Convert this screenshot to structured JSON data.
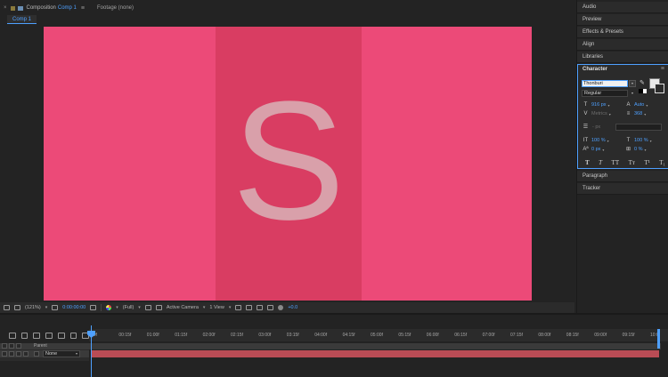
{
  "composition": {
    "close_label": "×",
    "label": "Composition",
    "name": "Comp 1",
    "menu_icon": "≡",
    "footage_label": "Footage (none)",
    "active_tab": "Comp 1",
    "canvas_letter": "S",
    "canvas_color": "#ec4a78",
    "band_color": "#d93d62"
  },
  "viewer_toolbar": {
    "zoom": "(121%)",
    "timecode": "0:00:00:00",
    "resolution": "(Full)",
    "camera": "Active Camera",
    "views": "1 View",
    "exposure": "+0.0"
  },
  "right_panel": {
    "items_top": [
      "Audio",
      "Preview",
      "Effects & Presets",
      "Align",
      "Libraries"
    ],
    "character": {
      "title": "Character",
      "menu_icon": "≡",
      "font_family": "Thonburi",
      "font_style": "Regular",
      "font_size": "916 px",
      "leading": "Auto",
      "kerning": "Metrics",
      "tracking": "368",
      "stroke_width": "- px",
      "vertical_scale": "100 %",
      "horizontal_scale": "100 %",
      "baseline_shift": "0 px",
      "tsume": "0 %",
      "type_styles": [
        "T",
        "T",
        "TT",
        "Tт",
        "T¹",
        "T₁"
      ]
    },
    "items_bottom": [
      "Paragraph",
      "Tracker"
    ]
  },
  "timeline": {
    "ticks": [
      "00f",
      "00:15f",
      "01:00f",
      "01:15f",
      "02:00f",
      "02:15f",
      "03:00f",
      "03:15f",
      "04:00f",
      "04:15f",
      "05:00f",
      "05:15f",
      "06:00f",
      "06:15f",
      "07:00f",
      "07:15f",
      "08:00f",
      "08:15f",
      "09:00f",
      "09:15f",
      "10:0"
    ],
    "parent_header": "Parent",
    "parent_value": "None"
  }
}
